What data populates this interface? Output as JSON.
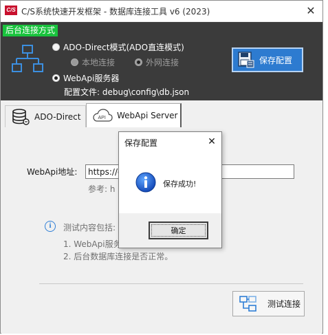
{
  "window": {
    "app_icon": "C/S",
    "title": "C/S系统快速开发框架 - 数据库连接工具 v6 (2023)",
    "close_glyph": "✕"
  },
  "header": {
    "badge": "后台连接方式",
    "mode_ado": "ADO-Direct模式(ADO直连模式)",
    "mode_ado_local": "本地连接",
    "mode_ado_remote": "外网连接",
    "mode_webapi": "WebApi服务器",
    "config_file": "配置文件: debug\\config\\db.json",
    "save_button": "保存配置",
    "selected_mode": "WebApi服务器",
    "icons": {
      "network": "network-topology-icon",
      "save": "save-config-icon"
    }
  },
  "tabs": [
    {
      "label": "ADO-Direct",
      "icon": "database-icon",
      "active": false
    },
    {
      "label": "WebApi Server",
      "icon": "cloud-api-icon",
      "active": true
    }
  ],
  "webapi": {
    "address_label": "WebApi地址:",
    "address_value": "https://c",
    "reference_label": "参考: h",
    "info_title": "测试内容包括:",
    "info_lines": [
      "1. WebApi服务",
      "2. 后台数据库连接是否正常。"
    ],
    "test_button": "测试连接"
  },
  "dialog": {
    "title": "保存配置",
    "message": "保存成功!",
    "ok_button": "确定",
    "close_glyph": "✕",
    "icon": "information-icon"
  },
  "colors": {
    "header_bg": "#3b3b3b",
    "badge_bg": "#19c33d",
    "save_button_bg": "#2d7bd0",
    "accent_blue": "#2f7fd6"
  }
}
